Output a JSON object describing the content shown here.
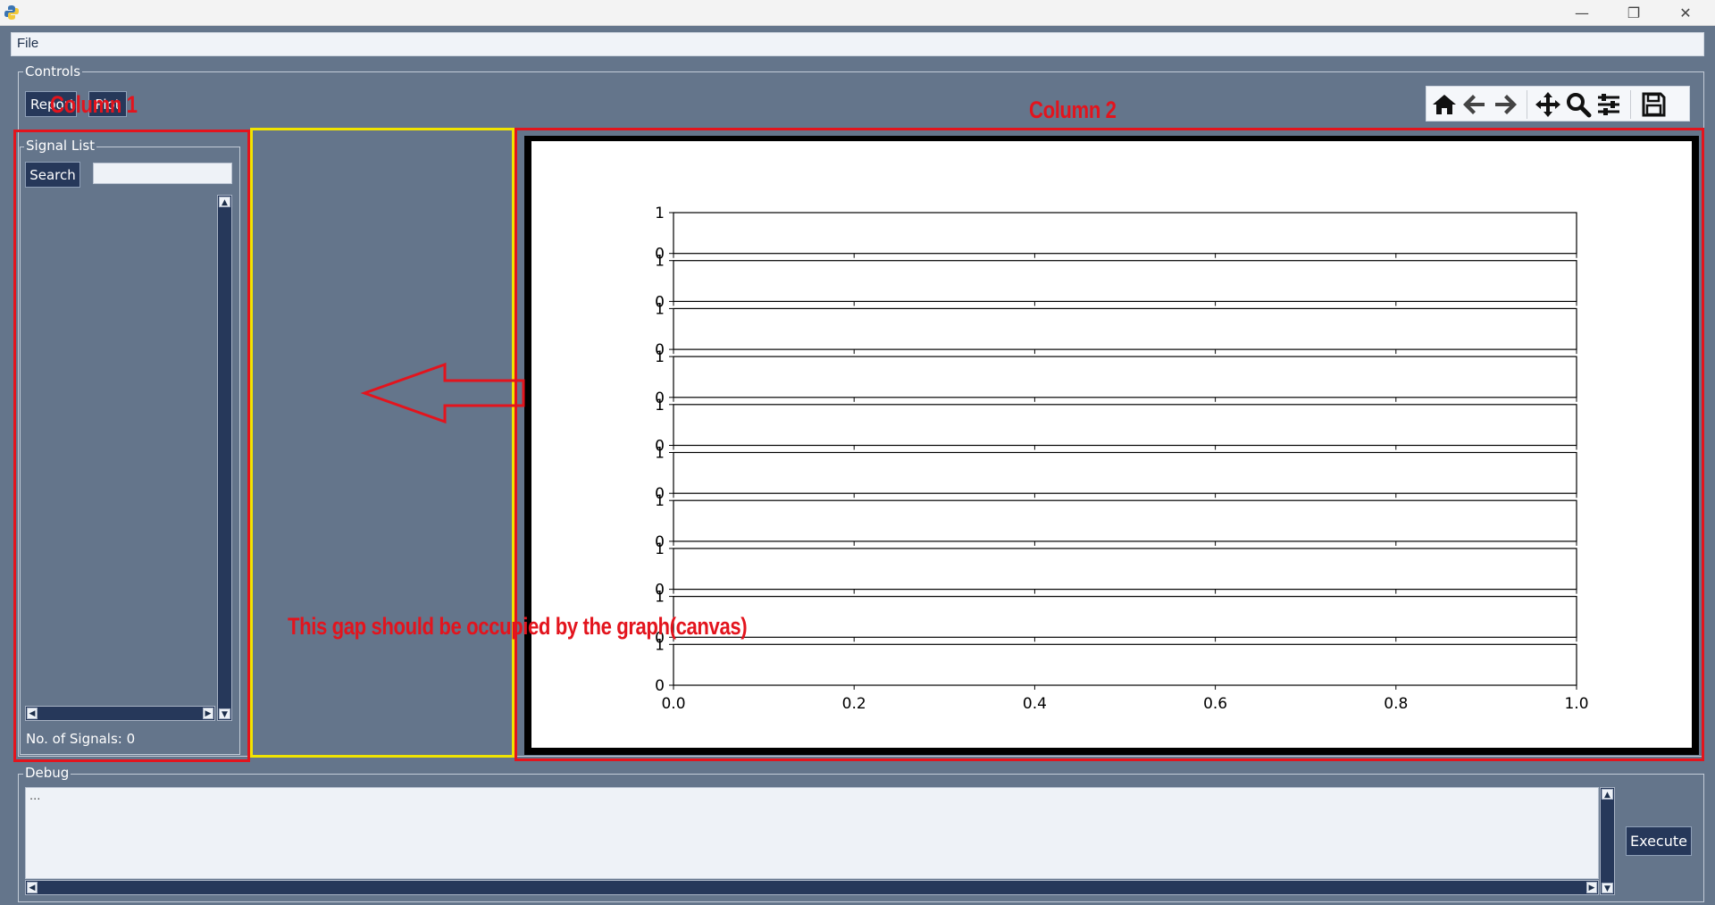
{
  "menu": {
    "file_label": "File"
  },
  "controls": {
    "frame_label": "Controls",
    "report_button_label": "Report",
    "second_button_label": "Plot"
  },
  "signal_list": {
    "frame_label": "Signal List",
    "search_button_label": "Search",
    "search_value": "",
    "signal_count_text": "No. of Signals: 0"
  },
  "toolbar": {
    "tools": [
      "home-icon",
      "back-arrow-icon",
      "forward-arrow-icon",
      "pan-icon",
      "zoom-icon",
      "configure-icon",
      "save-icon"
    ]
  },
  "plot": {
    "subplot_ytick_top": "1",
    "subplot_ytick_bottom": "0",
    "subplot_count": 10,
    "x_ticks": [
      "0.0",
      "0.2",
      "0.4",
      "0.6",
      "0.8",
      "1.0"
    ]
  },
  "debug": {
    "frame_label": "Debug",
    "text": "...",
    "execute_button_label": "Execute"
  },
  "annotations": {
    "column1_label": "Column 1",
    "column2_label": "Column 2",
    "gap_note": "This gap should be occupied by the graph(canvas)",
    "colors": {
      "red": "#e3141d",
      "yellow": "#f0e400"
    }
  },
  "theme": {
    "background": "#64758b",
    "button_bg": "#26385a"
  }
}
